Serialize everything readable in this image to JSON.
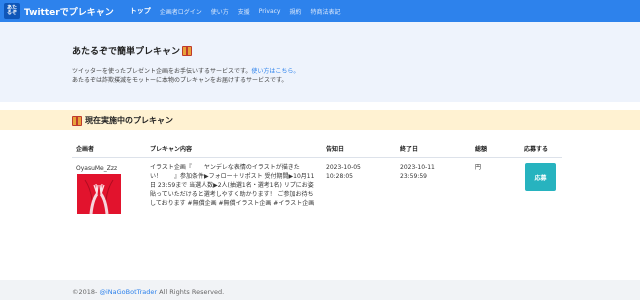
{
  "nav": {
    "logo_lines": [
      "あた",
      "るぞ"
    ],
    "brand": "Twitterでプレキャン",
    "items": [
      "トップ",
      "企画者ログイン",
      "使い方",
      "支援",
      "Privacy",
      "規約",
      "特商法表記"
    ]
  },
  "hero": {
    "title": "あたるぞで簡単プレキャン",
    "desc_line1": "ツイッターを使ったプレゼント企画をお手伝いするサービスです。",
    "desc_link": "使い方はこちら。",
    "desc_line2": "あたるぞは詐欺撲滅をモットーに本物のプレキャンをお届けするサービスです。"
  },
  "section": {
    "title": "現在実施中のプレキャン"
  },
  "table": {
    "headers": [
      "企画者",
      "プレキャン内容",
      "告知日",
      "終了日",
      "総額",
      "応募する"
    ],
    "rows": [
      {
        "organizer": "OyasuMe_Zzz",
        "content": "イラスト企画『　　ヤンデレな表情のイラストが描きたい！　　』参加条件▶フォロー＋リポスト 受付期間▶10月11日 23:59まで 当選人数▶2人(抽選1名・選考1名) リプにお姿貼っていただけると選考しやすく助かります！ ご参加お待ちしております #無償企画 #無償イラスト企画 #イラスト企画",
        "announce_date": "2023-10-05",
        "announce_time": "10:28:05",
        "end_date": "2023-10-11",
        "end_time": "23:59:59",
        "amount": "円",
        "apply_label": "応募"
      }
    ]
  },
  "footer": {
    "prefix": "©2018- ",
    "link": "@iNaGoBotTrader",
    "suffix": " All Rights Reserved."
  },
  "colors": {
    "nav": "#2d82ec",
    "hero_bg": "#eef3fc",
    "banner_bg": "#fff2d2",
    "apply_button": "#27b3bf",
    "avatar_bg": "#e2132d"
  },
  "icons": [
    "gift-icon"
  ]
}
